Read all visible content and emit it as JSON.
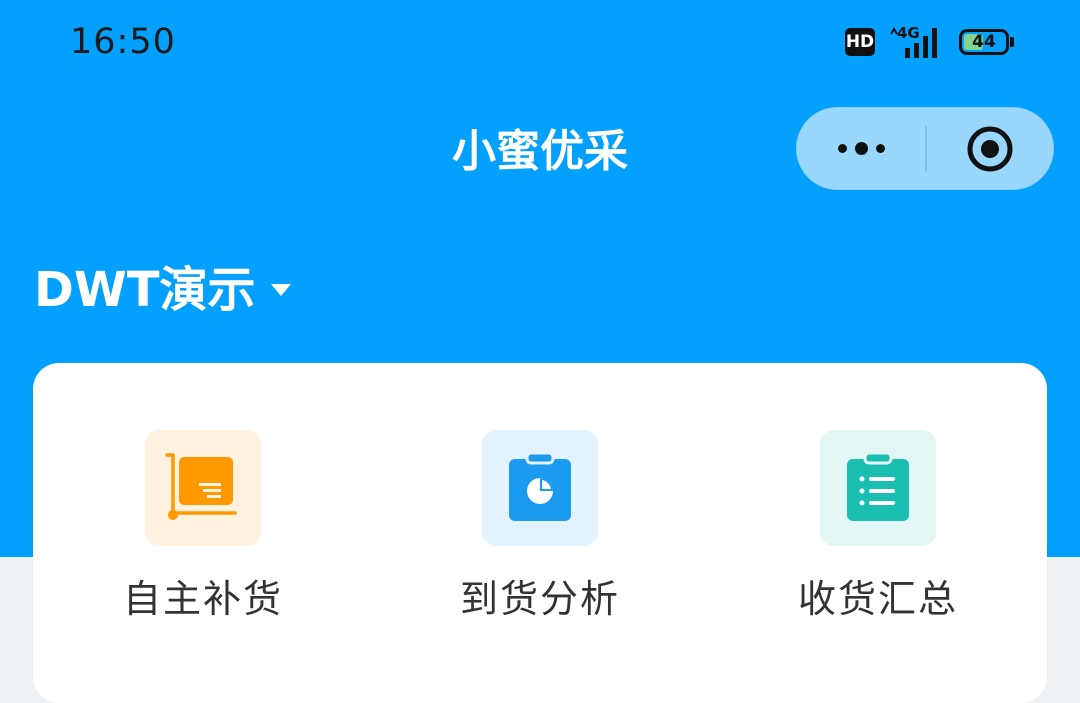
{
  "status_bar": {
    "time": "16:50",
    "hd_label": "HD",
    "network_label": "4G",
    "battery_level": "44"
  },
  "navbar": {
    "title": "小蜜优采"
  },
  "store_selector": {
    "name": "DWT演示"
  },
  "menu": {
    "items": [
      {
        "label": "自主补货",
        "icon": "replenish-cart-icon",
        "color": "#ff9900",
        "bg": "#fff3e0"
      },
      {
        "label": "到货分析",
        "icon": "arrival-analysis-icon",
        "color": "#1a9bf0",
        "bg": "#e3f3fd"
      },
      {
        "label": "收货汇总",
        "icon": "receipt-summary-icon",
        "color": "#1bbfb1",
        "bg": "#e2f7f5"
      }
    ]
  },
  "colors": {
    "brand": "#03a1fd",
    "page_bg": "#eff2f5"
  }
}
